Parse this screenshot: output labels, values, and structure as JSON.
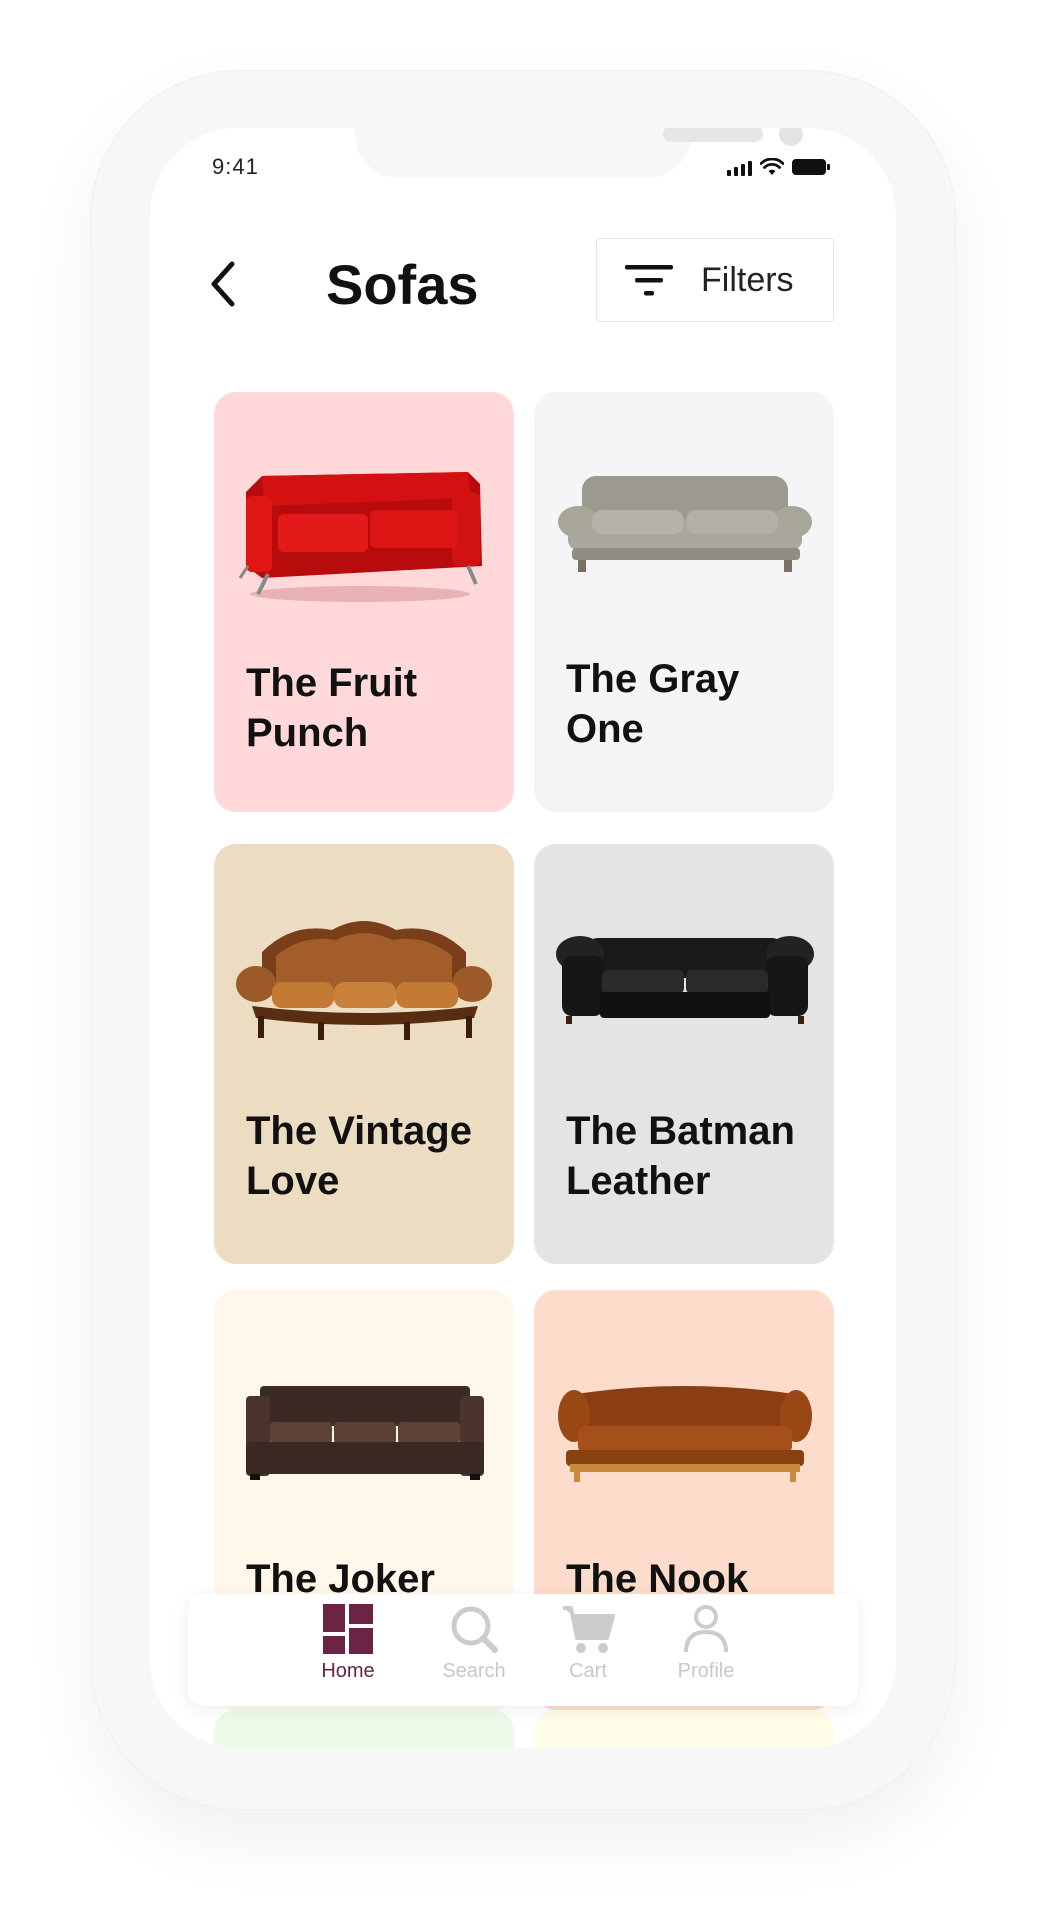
{
  "status_bar": {
    "time": "9:41"
  },
  "header": {
    "title": "Sofas",
    "back_icon": "chevron-left-icon",
    "filters_label": "Filters",
    "filters_icon": "filter-lines-icon"
  },
  "products": [
    {
      "name": "The Fruit Punch",
      "bg": "#ffd9da",
      "sofa": "red-leather-sofa"
    },
    {
      "name": "The Gray One",
      "bg": "#f4f5f7",
      "sofa": "gray-fabric-sofa"
    },
    {
      "name": "The Vintage Love",
      "bg": "#ebdcc2",
      "sofa": "vintage-tufted-sofa"
    },
    {
      "name": "The Batman Leather",
      "bg": "#e4e4e5",
      "sofa": "black-chesterfield-sofa"
    },
    {
      "name": "The Joker",
      "bg": "#fff8ea",
      "sofa": "dark-brown-leather-sofa"
    },
    {
      "name": "The Nook",
      "bg": "#fddccb",
      "sofa": "rust-velvet-sofa"
    }
  ],
  "peek_cards": [
    {
      "bg": "#eefbe8"
    },
    {
      "bg": "#fdfde8"
    }
  ],
  "bottom_nav": {
    "items": [
      {
        "label": "Home",
        "icon": "grid-home-icon",
        "active": true
      },
      {
        "label": "Search",
        "icon": "search-icon",
        "active": false
      },
      {
        "label": "Cart",
        "icon": "cart-icon",
        "active": false
      },
      {
        "label": "Profile",
        "icon": "person-icon",
        "active": false
      }
    ]
  },
  "colors": {
    "accent": "#6b2444",
    "inactive": "#c8c8c8"
  }
}
